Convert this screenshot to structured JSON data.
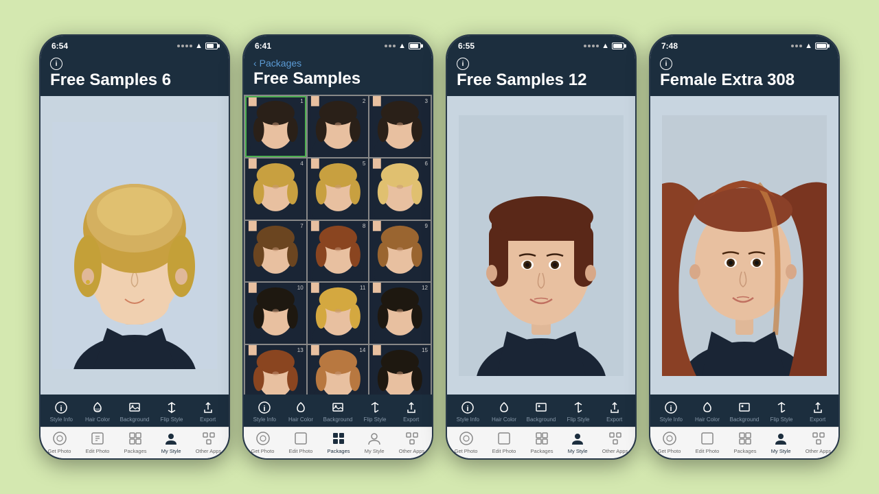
{
  "background": "#d4e8b0",
  "phones": [
    {
      "id": "phone1",
      "time": "6:54",
      "title": "Free Samples 6",
      "show_back": false,
      "active_tab": "my-style",
      "toolbar": {
        "items": [
          "Style Info",
          "Hair Color",
          "Background",
          "Flip Style",
          "Export"
        ]
      },
      "nav": {
        "items": [
          "Get Photo",
          "Edit Photo",
          "Packages",
          "My Style",
          "Other Apps"
        ]
      }
    },
    {
      "id": "phone2",
      "time": "6:41",
      "title": "Free Samples",
      "show_back": true,
      "back_label": "Packages",
      "active_tab": "packages",
      "grid_items": [
        {
          "num": 1,
          "selected": true,
          "hair_class": "h-dark-short"
        },
        {
          "num": 2,
          "selected": false,
          "hair_class": "h-dark-short"
        },
        {
          "num": 3,
          "selected": false,
          "hair_class": "h-dark-short"
        },
        {
          "num": 4,
          "selected": false,
          "hair_class": "h-blonde-short"
        },
        {
          "num": 5,
          "selected": false,
          "hair_class": "h-blonde-short"
        },
        {
          "num": 6,
          "selected": false,
          "hair_class": "h-light"
        },
        {
          "num": 7,
          "selected": false,
          "hair_class": "h-brown-short"
        },
        {
          "num": 8,
          "selected": false,
          "hair_class": "h-auburn"
        },
        {
          "num": 9,
          "selected": false,
          "hair_class": "h-wavy-brown"
        },
        {
          "num": 10,
          "selected": false,
          "hair_class": "h-dark-bob"
        },
        {
          "num": 11,
          "selected": false,
          "hair_class": "h-golden"
        },
        {
          "num": 12,
          "selected": false,
          "hair_class": "h-dark-bob"
        },
        {
          "num": 13,
          "selected": false,
          "hair_class": "h-auburn"
        },
        {
          "num": 14,
          "selected": false,
          "hair_class": "h-caramel"
        },
        {
          "num": 15,
          "selected": false,
          "hair_class": "h-dark-bob"
        }
      ],
      "toolbar": {
        "items": [
          "Style Info",
          "Hair Color",
          "Background",
          "Flip Style",
          "Export"
        ]
      },
      "nav": {
        "items": [
          "Get Photo",
          "Edit Photo",
          "Packages",
          "My Style",
          "Other Apps"
        ]
      }
    },
    {
      "id": "phone3",
      "time": "6:55",
      "title": "Free Samples 12",
      "show_back": false,
      "active_tab": "my-style",
      "toolbar": {
        "items": [
          "Style Info",
          "Hair Color",
          "Background",
          "Flip Style",
          "Export"
        ]
      },
      "nav": {
        "items": [
          "Get Photo",
          "Edit Photo",
          "Packages",
          "My Style",
          "Other Apps"
        ]
      }
    },
    {
      "id": "phone4",
      "time": "7:48",
      "title": "Female Extra 308",
      "show_back": false,
      "active_tab": "my-style",
      "toolbar": {
        "items": [
          "Style Info",
          "Hair Color",
          "Background",
          "Flip Style",
          "Export"
        ]
      },
      "nav": {
        "items": [
          "Get Photo",
          "Edit Photo",
          "Packages",
          "My Style",
          "Other Apps"
        ]
      }
    }
  ]
}
